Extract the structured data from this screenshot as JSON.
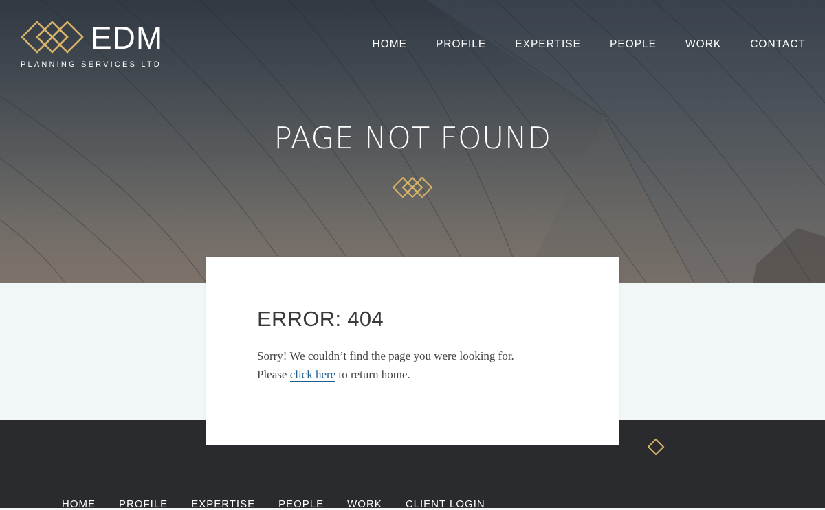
{
  "brand": {
    "name": "EDM",
    "tagline": "PLANNING SERVICES LTD",
    "accent_color": "#d8b36a"
  },
  "nav": {
    "items": [
      {
        "label": "HOME"
      },
      {
        "label": "PROFILE"
      },
      {
        "label": "EXPERTISE"
      },
      {
        "label": "PEOPLE"
      },
      {
        "label": "WORK"
      },
      {
        "label": "CONTACT"
      }
    ]
  },
  "hero": {
    "title": "PAGE NOT FOUND",
    "icon": "diamond-logo-icon"
  },
  "error": {
    "title": "ERROR: 404",
    "line1": "Sorry! We couldn’t find the page you were looking for.",
    "line2_prefix": "Please ",
    "link_text": "click here",
    "line2_suffix": " to return home."
  },
  "footer": {
    "nav": [
      {
        "label": "HOME"
      },
      {
        "label": "PROFILE"
      },
      {
        "label": "EXPERTISE"
      },
      {
        "label": "PEOPLE"
      },
      {
        "label": "WORK"
      },
      {
        "label": "CLIENT LOGIN"
      }
    ]
  }
}
